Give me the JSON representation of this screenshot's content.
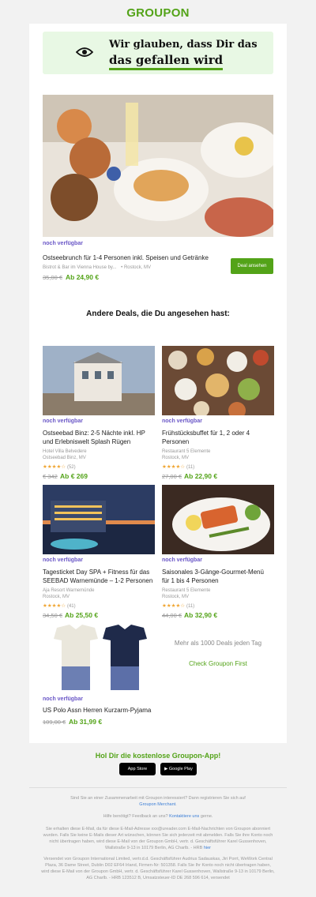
{
  "brand": {
    "logo": "GROUPON"
  },
  "banner": {
    "line1": "Wir glauben, dass Dir das",
    "line2": "das gefallen wird"
  },
  "hero_deal": {
    "availability": "noch verfügbar",
    "title": "Ostseebrunch für 1-4 Personen inkl. Speisen und Getränke",
    "merchant": "Bistrot & Bar im Vienna House by...",
    "location": "Rostock, MV",
    "old_price": "35,00 €",
    "new_price": "Ab 24,90 €",
    "button_label": "Deal ansehen"
  },
  "section_title": "Andere Deals, die Du angesehen hast:",
  "deals": [
    {
      "availability": "noch verfügbar",
      "title_line1": "Ostseebad Binz: 2-5 Nächte inkl. HP",
      "title_line2": "und Erlebniswelt Splash Rügen",
      "merchant": "Hotel Villa Belvedere",
      "location": "Ostseebad Binz, MV",
      "stars": "★★★★☆",
      "reviews": "(52)",
      "old_price": "€ 342",
      "new_price": "Ab € 269"
    },
    {
      "availability": "noch verfügbar",
      "title_line1": "Frühstücksbuffet für 1, 2 oder 4",
      "title_line2": "Personen",
      "merchant": "Restaurant 5 Elemente",
      "location": "Rostock, MV",
      "stars": "★★★★☆",
      "reviews": "(11)",
      "old_price": "27,00 €",
      "new_price": "Ab 22,90 €"
    },
    {
      "availability": "noch verfügbar",
      "title_line1": "Tagesticket Day SPA + Fitness für das",
      "title_line2": "SEEBAD Warnemünde – 1-2 Personen",
      "merchant": "Aja Resort Warnemünde",
      "location": "Rostock, MV",
      "stars": "★★★★☆",
      "reviews": "(41)",
      "old_price": "34,50 €",
      "new_price": "Ab 25,50 €"
    },
    {
      "availability": "noch verfügbar",
      "title_line1": "Saisonales 3-Gänge-Gourmet-Menü",
      "title_line2": "für 1 bis 4 Personen",
      "merchant": "Restaurant 5 Elemente",
      "location": "Rostock, MV",
      "stars": "★★★★☆",
      "reviews": "(11)",
      "old_price": "44,00 €",
      "new_price": "Ab 32,90 €"
    },
    {
      "availability": "noch verfügbar",
      "title_line1": "US Polo Assn Herren Kurzarm-Pyjama",
      "old_price": "109,00 €",
      "new_price": "Ab 31,99 €"
    }
  ],
  "more_deals": "Mehr als 1000 Deals jeden Tag",
  "check_first": "Check Groupon First",
  "app": {
    "title": "Hol Dir die kostenlose Groupon-App!",
    "app_store": "App Store",
    "google_play": "Google Play"
  },
  "footer": {
    "merchant_q": "Sind Sie an einer Zusammenarbeit mit Groupon interessiert? Dann registrieren Sie sich auf",
    "merchant_link": "Groupon Merchant",
    "help": "Hilfe benötigt? Feedback an uns?",
    "help_link": "Kontaktiere uns",
    "help_suffix": "gerne.",
    "unsub": "Sie erhalten diese E-Mail, da für diese E-Mail-Adresse xxx@ureader.com E-Mail-Nachrichten von Groupon abonniert wurden. Falls Sie keine E-Mails dieser Art wünschen, können Sie sich jederzeit mit abmelden. Falls Sie ihre Konto noch nicht übertragen haben, wird diese E-Mail von der Groupon GmbH, vertr. d. Geschäftsführer Karel Gussenhoven, Wallstraße 9-13 in 10179 Berlin, AG Charlb. - HRB",
    "unsub_link": "hier",
    "legal": "Versendet von Groupon International Limited, vertr.d.d. Geschäftsführer Audrius Sadauskas, Jiri Porrt, WeWork Central Plaza, 36 Dame Street, Dublin D02 EF64 Irland, Firmen-Nr: 501358. Falls Sie Ihr Konto noch nicht übertragen haben, wird diese E-Mail von der Groupon GmbH, vertr. d. Geschäftsführer Karel Gussenhoven, Wallstraße 9-13 in 10179 Berlin, AG Charlb. - HRB 123512 B, Umsatzsteuer-ID DE 268 596 614, versendet"
  },
  "colors": {
    "brand_green": "#53a318",
    "availability_purple": "#6a57c7",
    "banner_bg": "#e8f8e4"
  }
}
